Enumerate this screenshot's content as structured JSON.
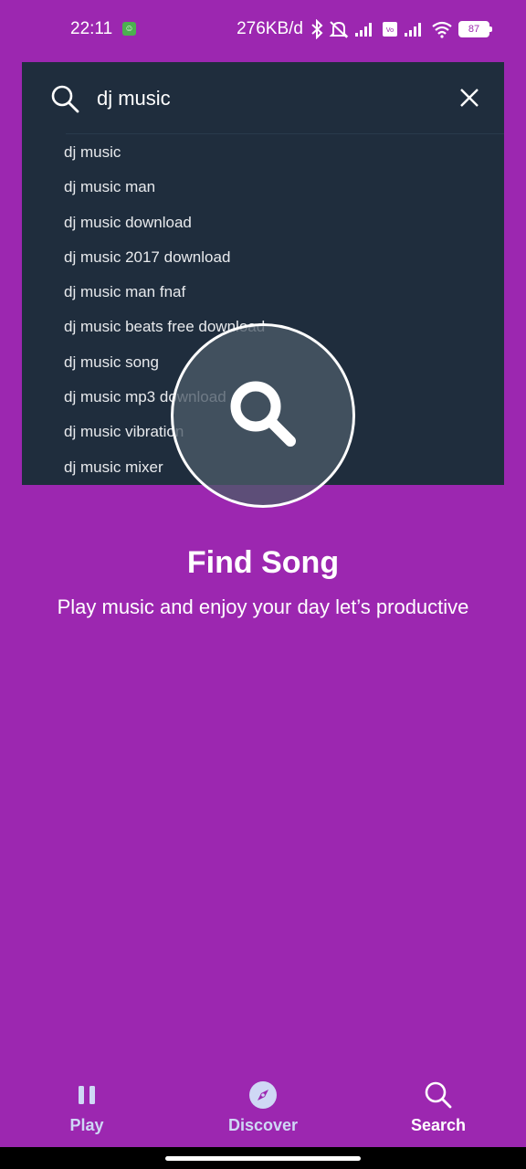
{
  "status_bar": {
    "time": "22:11",
    "net_speed": "276KB/d",
    "battery": "87",
    "icons": [
      "app-notification-icon",
      "bluetooth-icon",
      "mute-icon",
      "signal-icon",
      "volte-icon",
      "signal-icon",
      "wifi-icon",
      "battery-icon"
    ]
  },
  "search": {
    "query": "dj music",
    "suggestions": [
      "dj music",
      "dj music man",
      "dj music download",
      "dj music 2017 download",
      "dj music man fnaf",
      "dj music beats free download",
      "dj music song",
      "dj music mp3 download",
      "dj music vibration",
      "dj music mixer"
    ]
  },
  "hero": {
    "title": "Find Song",
    "subtitle": "Play music and enjoy your day let’s productive"
  },
  "nav": {
    "play_label": "Play",
    "discover_label": "Discover",
    "search_label": "Search"
  },
  "colors": {
    "background": "#9c27b0",
    "panel": "#1f2d3d",
    "nav_inactive": "#cfd8f5",
    "nav_active": "#ffffff"
  }
}
